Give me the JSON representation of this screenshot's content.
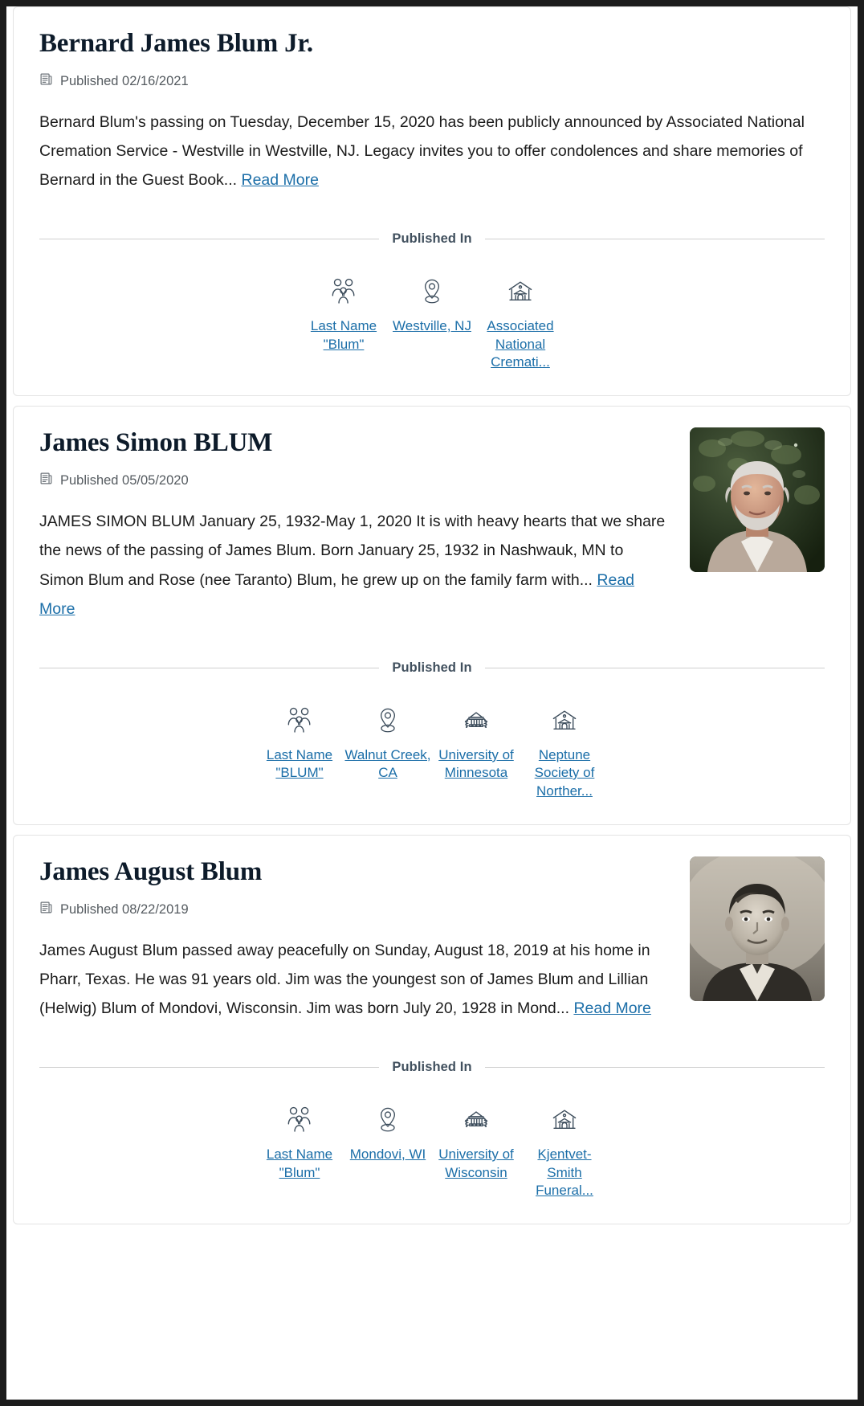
{
  "colors": {
    "link": "#1b6ea8",
    "title": "#0d1b2a",
    "body": "#1b1b1b",
    "meta": "#555b60",
    "divider_label": "#41505e",
    "rule": "#cfcfcf",
    "card_border": "#e3e3e3",
    "page_bg": "#ffffff",
    "outer_bg": "#1c1c1c"
  },
  "published_in_label": "Published In",
  "read_more_label": "Read More",
  "published_prefix": "Published",
  "cards": [
    {
      "title": "Bernard James Blum Jr.",
      "published_icon": "newspaper-icon",
      "published_date": "02/16/2021",
      "published_text": "Published 02/16/2021",
      "excerpt": "Bernard Blum's passing on Tuesday, December 15, 2020 has been publicly announced by Associated National Cremation Service - Westville in Westville, NJ. Legacy invites you to offer condolences and share memories of Bernard in the Guest Book...",
      "read_more": "Read More",
      "has_photo": false,
      "photo_alt": "",
      "published_in": [
        {
          "icon": "family-icon",
          "label": "Last Name \"Blum\""
        },
        {
          "icon": "map-pin-icon",
          "label": "Westville, NJ"
        },
        {
          "icon": "funeral-home-icon",
          "label": "Associated National Cremati..."
        }
      ]
    },
    {
      "title": "James Simon BLUM",
      "published_icon": "newspaper-icon",
      "published_date": "05/05/2020",
      "published_text": "Published 05/05/2020",
      "excerpt": "JAMES SIMON BLUM January 25, 1932-May 1, 2020 It is with heavy hearts that we share the news of the passing of James Blum. Born January 25, 1932 in Nashwauk, MN to Simon Blum and Rose (nee Taranto) Blum, he grew up on the family farm with...",
      "read_more": "Read More",
      "has_photo": true,
      "photo_alt": "Color photo of an older man with white hair and beard outdoors in front of green foliage",
      "published_in": [
        {
          "icon": "family-icon",
          "label": "Last Name \"BLUM\""
        },
        {
          "icon": "map-pin-icon",
          "label": "Walnut Creek, CA"
        },
        {
          "icon": "university-icon",
          "label": "University of Minnesota"
        },
        {
          "icon": "funeral-home-icon",
          "label": "Neptune Society of Norther..."
        }
      ]
    },
    {
      "title": "James August Blum",
      "published_icon": "newspaper-icon",
      "published_date": "08/22/2019",
      "published_text": "Published 08/22/2019",
      "excerpt": "James August Blum passed away peacefully on Sunday, August 18, 2019 at his home in Pharr, Texas. He was 91 years old. Jim was the youngest son of James Blum and Lillian (Helwig) Blum of Mondovi, Wisconsin. Jim was born July 20, 1928 in Mond...",
      "read_more": "Read More",
      "has_photo": true,
      "photo_alt": "Black and white vintage portrait photograph of a young man in a suit",
      "published_in": [
        {
          "icon": "family-icon",
          "label": "Last Name \"Blum\""
        },
        {
          "icon": "map-pin-icon",
          "label": "Mondovi, WI"
        },
        {
          "icon": "university-icon",
          "label": "University of Wisconsin"
        },
        {
          "icon": "funeral-home-icon",
          "label": "Kjentvet-Smith Funeral..."
        }
      ]
    }
  ]
}
